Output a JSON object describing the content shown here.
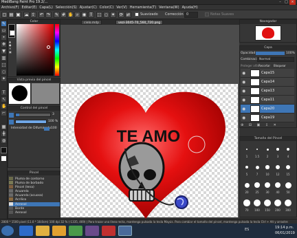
{
  "app": {
    "title": "MediBang Paint Pro 19.2/..."
  },
  "menu": [
    "Archivo(F)",
    "Editar(E)",
    "Capa(L)",
    "Selección(S)",
    "Ajustar(C)",
    "Color(C)",
    "Ver(V)",
    "Herramienta(T)",
    "Ventana(W)",
    "Ayuda(H)"
  ],
  "toolbar": {
    "suavizado_label": "Suavizado",
    "correccion_label": "Corrección",
    "correccion_value": "0",
    "notas_label": "Notas Suaves"
  },
  "tabs": [
    "cielo.mdp",
    "vezi-3045-70_560_720.png"
  ],
  "panels": {
    "color": "Color",
    "brush_preview": "Vista previa del pincel",
    "brush_control": "Control del pincel",
    "brush_control_val1": "3",
    "brush_control_val2": "100 %",
    "brush_control_blur_label": "Intensidad de Difuminado",
    "brush_control_blur_val": "100",
    "brush_list": "Pincel",
    "navigator": "Navegador",
    "layer": "Capa",
    "opacity_label": "Opacidad",
    "opacity_val": "100%",
    "blend_label": "Combinación",
    "blend_val": "Normal",
    "protect_label": "Proteger alfa",
    "clip_label": "Recortar",
    "lock_label": "Bloquear",
    "brush_size": "Tamaño del Pincel"
  },
  "layers": [
    {
      "name": "Capa15",
      "selected": false
    },
    {
      "name": "Capa14",
      "selected": false
    },
    {
      "name": "Capa13",
      "selected": false
    },
    {
      "name": "Capa11",
      "selected": false
    },
    {
      "name": "Capa20",
      "selected": true
    },
    {
      "name": "Capa19",
      "selected": false
    }
  ],
  "brushes": [
    {
      "name": "Pluma de contorno",
      "color": "#6a6a4a",
      "selected": false
    },
    {
      "name": "Pluma de borbado",
      "color": "#7a7a55",
      "selected": false
    },
    {
      "name": "Pincel (lena)",
      "color": "#806040",
      "selected": false
    },
    {
      "name": "Acuarela",
      "color": "#6a6a6a",
      "selected": false
    },
    {
      "name": "Acuarela (acuosa)",
      "color": "#6a6a6a",
      "selected": false
    },
    {
      "name": "Acrílico",
      "color": "#8a6a40",
      "selected": false
    },
    {
      "name": "Aerosol",
      "color": "#3e76b6",
      "selected": true
    },
    {
      "name": "Borde",
      "color": "#555555",
      "selected": false
    },
    {
      "name": "Aerosol",
      "color": "#555555",
      "selected": false
    }
  ],
  "brush_sizes": [
    "1",
    "1.5",
    "2",
    "3",
    "4",
    "5",
    "7",
    "10",
    "12",
    "15",
    "20",
    "25",
    "30",
    "40",
    "50",
    "70",
    "100",
    "150",
    "200",
    "300"
  ],
  "canvas": {
    "heart_text": "TE AMO"
  },
  "status": {
    "text": "2800 * 1500 pixel  (11.0 * 18.8cm)  100 dpi  32 %  (-1335, 469)  |  Para trazar una línea recta, mantenga pulsada la tecla Mayús. Para cambiar el tamaño del pincel, mantenga pulsada la tecla Ctrl + Alt y arrastre"
  },
  "taskbar": {
    "lang": "ES",
    "time": "19:14 p.m.",
    "date": "06/01/2019"
  },
  "colors": {
    "heart": "#e01010",
    "accent": "#3e76b6",
    "taskbar": "#1f2c3d"
  }
}
